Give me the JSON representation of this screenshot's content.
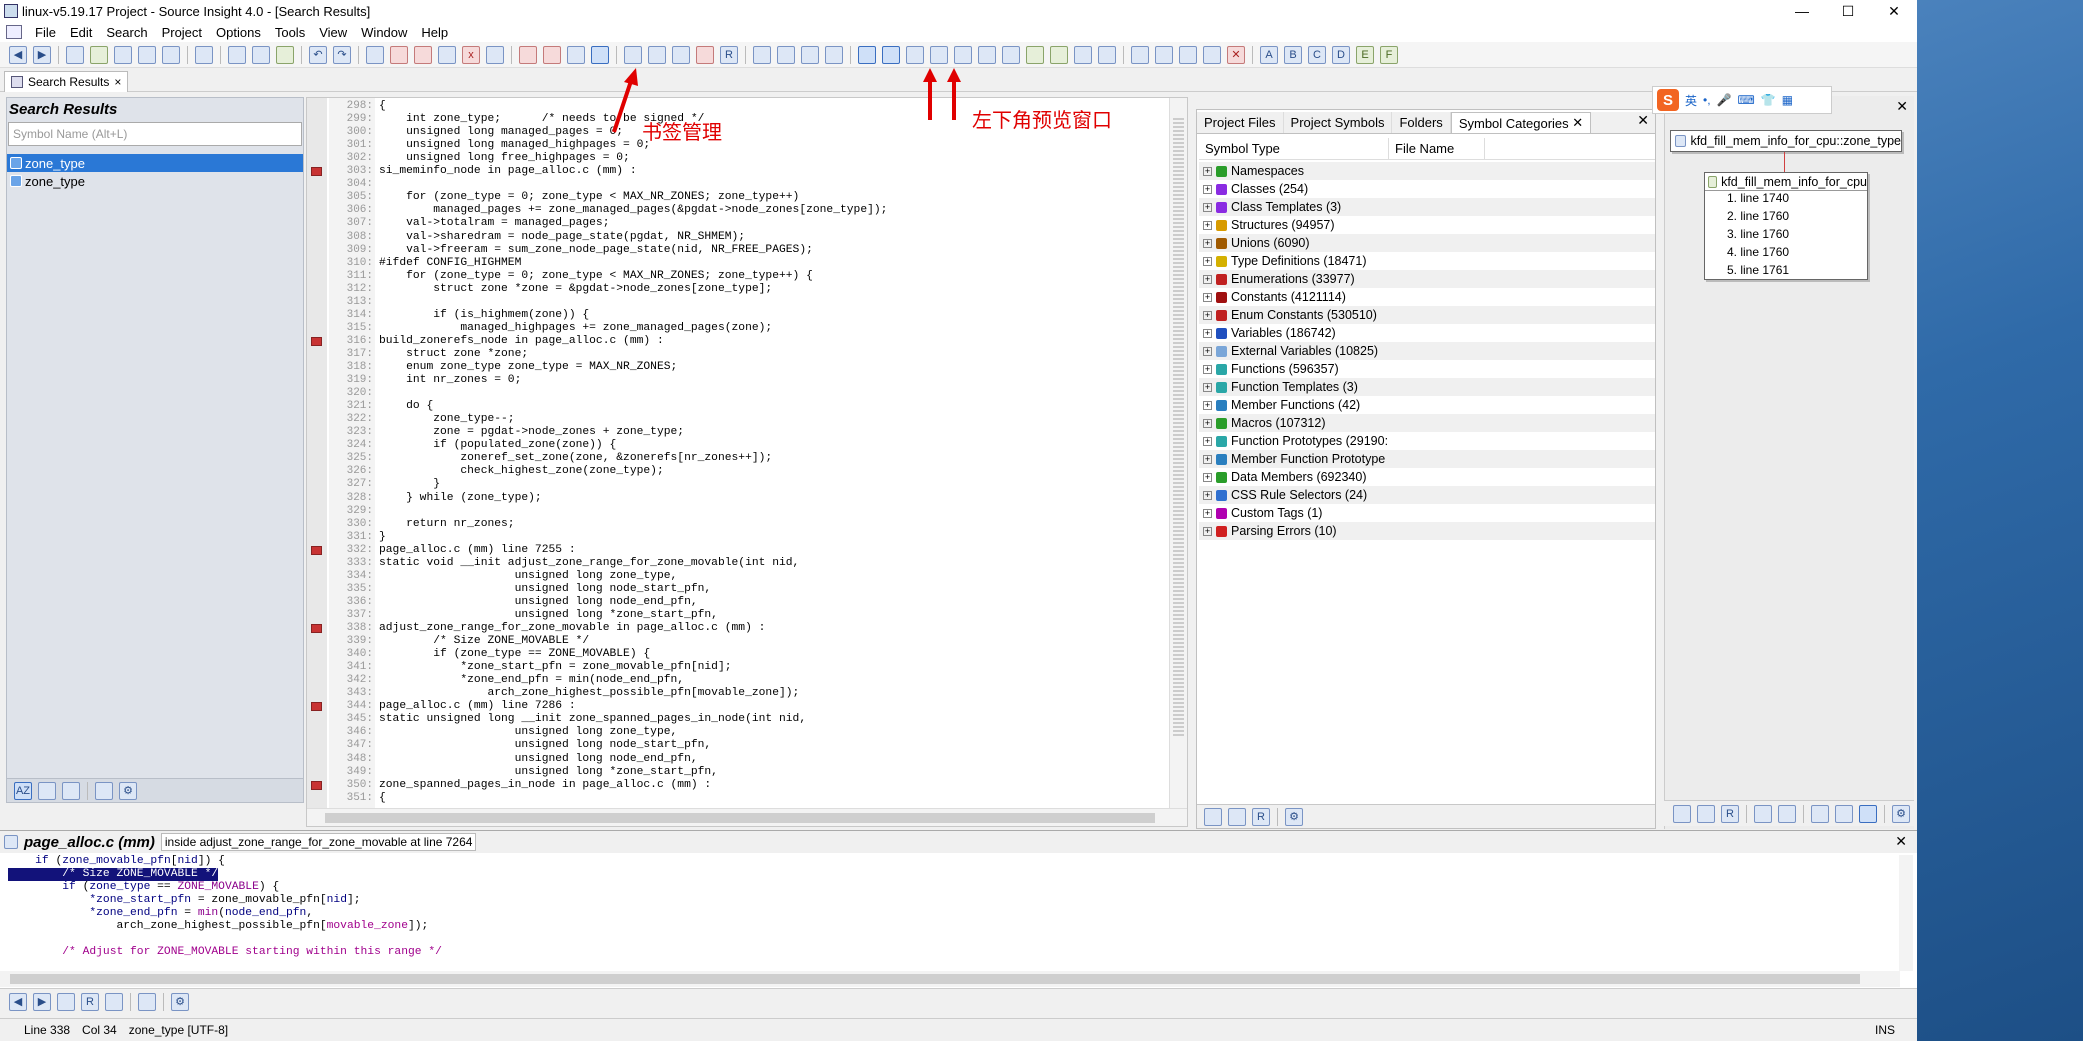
{
  "window": {
    "title": "linux-v5.19.17 Project - Source Insight 4.0 - [Search Results]",
    "controls": [
      "—",
      "☐",
      "✕"
    ]
  },
  "menu": [
    "File",
    "Edit",
    "Search",
    "Project",
    "Options",
    "Tools",
    "View",
    "Window",
    "Help"
  ],
  "tabs": [
    {
      "label": "Search Results",
      "close": "×"
    }
  ],
  "search_panel": {
    "title": "Search Results",
    "placeholder": "Symbol Name (Alt+L)",
    "results": [
      "zone_type",
      "zone_type"
    ],
    "selected_index": 0
  },
  "annotations": {
    "bookmark_label": "书签管理",
    "preview_label": "左下角预览窗口",
    "color": "#e00000"
  },
  "editor": {
    "lines": [
      {
        "n": "298:",
        "t": "{"
      },
      {
        "n": "299:",
        "t": "    int zone_type;      /* needs to be signed */"
      },
      {
        "n": "300:",
        "t": "    unsigned long managed_pages = 0;"
      },
      {
        "n": "301:",
        "t": "    unsigned long managed_highpages = 0;"
      },
      {
        "n": "302:",
        "t": "    unsigned long free_highpages = 0;"
      },
      {
        "n": "303:",
        "t": "si_meminfo_node in page_alloc.c (mm) :"
      },
      {
        "n": "304:",
        "t": ""
      },
      {
        "n": "305:",
        "t": "    for (zone_type = 0; zone_type < MAX_NR_ZONES; zone_type++)"
      },
      {
        "n": "306:",
        "t": "        managed_pages += zone_managed_pages(&pgdat->node_zones[zone_type]);"
      },
      {
        "n": "307:",
        "t": "    val->totalram = managed_pages;"
      },
      {
        "n": "308:",
        "t": "    val->sharedram = node_page_state(pgdat, NR_SHMEM);"
      },
      {
        "n": "309:",
        "t": "    val->freeram = sum_zone_node_page_state(nid, NR_FREE_PAGES);"
      },
      {
        "n": "310:",
        "t": "#ifdef CONFIG_HIGHMEM"
      },
      {
        "n": "311:",
        "t": "    for (zone_type = 0; zone_type < MAX_NR_ZONES; zone_type++) {"
      },
      {
        "n": "312:",
        "t": "        struct zone *zone = &pgdat->node_zones[zone_type];"
      },
      {
        "n": "313:",
        "t": ""
      },
      {
        "n": "314:",
        "t": "        if (is_highmem(zone)) {"
      },
      {
        "n": "315:",
        "t": "            managed_highpages += zone_managed_pages(zone);"
      },
      {
        "n": "316:",
        "t": "build_zonerefs_node in page_alloc.c (mm) :"
      },
      {
        "n": "317:",
        "t": "    struct zone *zone;"
      },
      {
        "n": "318:",
        "t": "    enum zone_type zone_type = MAX_NR_ZONES;"
      },
      {
        "n": "319:",
        "t": "    int nr_zones = 0;"
      },
      {
        "n": "320:",
        "t": ""
      },
      {
        "n": "321:",
        "t": "    do {"
      },
      {
        "n": "322:",
        "t": "        zone_type--;"
      },
      {
        "n": "323:",
        "t": "        zone = pgdat->node_zones + zone_type;"
      },
      {
        "n": "324:",
        "t": "        if (populated_zone(zone)) {"
      },
      {
        "n": "325:",
        "t": "            zoneref_set_zone(zone, &zonerefs[nr_zones++]);"
      },
      {
        "n": "326:",
        "t": "            check_highest_zone(zone_type);"
      },
      {
        "n": "327:",
        "t": "        }"
      },
      {
        "n": "328:",
        "t": "    } while (zone_type);"
      },
      {
        "n": "329:",
        "t": ""
      },
      {
        "n": "330:",
        "t": "    return nr_zones;"
      },
      {
        "n": "331:",
        "t": "}"
      },
      {
        "n": "332:",
        "t": "page_alloc.c (mm) line 7255 :"
      },
      {
        "n": "333:",
        "t": "static void __init adjust_zone_range_for_zone_movable(int nid,"
      },
      {
        "n": "334:",
        "t": "                    unsigned long zone_type,"
      },
      {
        "n": "335:",
        "t": "                    unsigned long node_start_pfn,"
      },
      {
        "n": "336:",
        "t": "                    unsigned long node_end_pfn,"
      },
      {
        "n": "337:",
        "t": "                    unsigned long *zone_start_pfn,"
      },
      {
        "n": "338:",
        "t": "adjust_zone_range_for_zone_movable in page_alloc.c (mm) :"
      },
      {
        "n": "339:",
        "t": "        /* Size ZONE_MOVABLE */"
      },
      {
        "n": "340:",
        "t": "        if (zone_type == ZONE_MOVABLE) {"
      },
      {
        "n": "341:",
        "t": "            *zone_start_pfn = zone_movable_pfn[nid];"
      },
      {
        "n": "342:",
        "t": "            *zone_end_pfn = min(node_end_pfn,"
      },
      {
        "n": "343:",
        "t": "                arch_zone_highest_possible_pfn[movable_zone]);"
      },
      {
        "n": "344:",
        "t": "page_alloc.c (mm) line 7286 :"
      },
      {
        "n": "345:",
        "t": "static unsigned long __init zone_spanned_pages_in_node(int nid,"
      },
      {
        "n": "346:",
        "t": "                    unsigned long zone_type,"
      },
      {
        "n": "347:",
        "t": "                    unsigned long node_start_pfn,"
      },
      {
        "n": "348:",
        "t": "                    unsigned long node_end_pfn,"
      },
      {
        "n": "349:",
        "t": "                    unsigned long *zone_start_pfn,"
      },
      {
        "n": "350:",
        "t": "zone_spanned_pages_in_node in page_alloc.c (mm) :"
      },
      {
        "n": "351:",
        "t": "{"
      }
    ],
    "marked_lines": [
      "303:",
      "316:",
      "332:",
      "338:",
      "344:",
      "350:"
    ]
  },
  "symbol_window": {
    "tabs": [
      "Project Files",
      "Project Symbols",
      "Folders",
      "Symbol Categories"
    ],
    "active_tab": "Symbol Categories",
    "close": "✕",
    "columns": [
      "Symbol Type",
      "File Name"
    ],
    "categories": [
      {
        "label": "Namespaces",
        "color": "#2a9d2a"
      },
      {
        "label": "Classes (254)",
        "color": "#8a2be2"
      },
      {
        "label": "Class Templates (3)",
        "color": "#8a2be2"
      },
      {
        "label": "Structures (94957)",
        "color": "#d89b00"
      },
      {
        "label": "Unions (6090)",
        "color": "#a05a00"
      },
      {
        "label": "Type Definitions (18471)",
        "color": "#d4b000"
      },
      {
        "label": "Enumerations (33977)",
        "color": "#c02020"
      },
      {
        "label": "Constants (4121114)",
        "color": "#a01010"
      },
      {
        "label": "Enum Constants (530510)",
        "color": "#c02020"
      },
      {
        "label": "Variables (186742)",
        "color": "#1f4fbf"
      },
      {
        "label": "External Variables (10825)",
        "color": "#7aa6d8"
      },
      {
        "label": "Functions (596357)",
        "color": "#2aa7a7"
      },
      {
        "label": "Function Templates (3)",
        "color": "#2aa7a7"
      },
      {
        "label": "Member Functions (42)",
        "color": "#2a7fbf"
      },
      {
        "label": "Macros (107312)",
        "color": "#2a9d2a"
      },
      {
        "label": "Function Prototypes (29190:",
        "color": "#2aa7a7"
      },
      {
        "label": "Member Function Prototype",
        "color": "#2a7fbf"
      },
      {
        "label": "Data Members (692340)",
        "color": "#2a9d2a"
      },
      {
        "label": "CSS Rule Selectors (24)",
        "color": "#3070d0"
      },
      {
        "label": "Custom Tags (1)",
        "color": "#b000b0"
      },
      {
        "label": "Parsing Errors (10)",
        "color": "#d02020"
      }
    ]
  },
  "relation_window": {
    "close": "✕",
    "root": "kfd_fill_mem_info_for_cpu::zone_type",
    "node": "kfd_fill_mem_info_for_cpu",
    "refs": [
      "1. line 1740",
      "2. line 1760",
      "3. line 1760",
      "4. line 1760",
      "5. line 1761"
    ],
    "ime_label": "英"
  },
  "context_window": {
    "file": "page_alloc.c (mm)",
    "location": "inside adjust_zone_range_for_zone_movable at line 7264",
    "close": "✕",
    "lines": [
      "    if (zone_movable_pfn[nid]) {",
      "        /* Size ZONE_MOVABLE */",
      "        if (zone_type == ZONE_MOVABLE) {",
      "            *zone_start_pfn = zone_movable_pfn[nid];",
      "            *zone_end_pfn = min(node_end_pfn,",
      "                arch_zone_highest_possible_pfn[movable_zone]);",
      "",
      "        /* Adjust for ZONE_MOVABLE starting within this range */"
    ]
  },
  "status": {
    "line": "Line 338",
    "col": "Col 34",
    "symbol": "zone_type [UTF-8]",
    "mode": "INS"
  }
}
